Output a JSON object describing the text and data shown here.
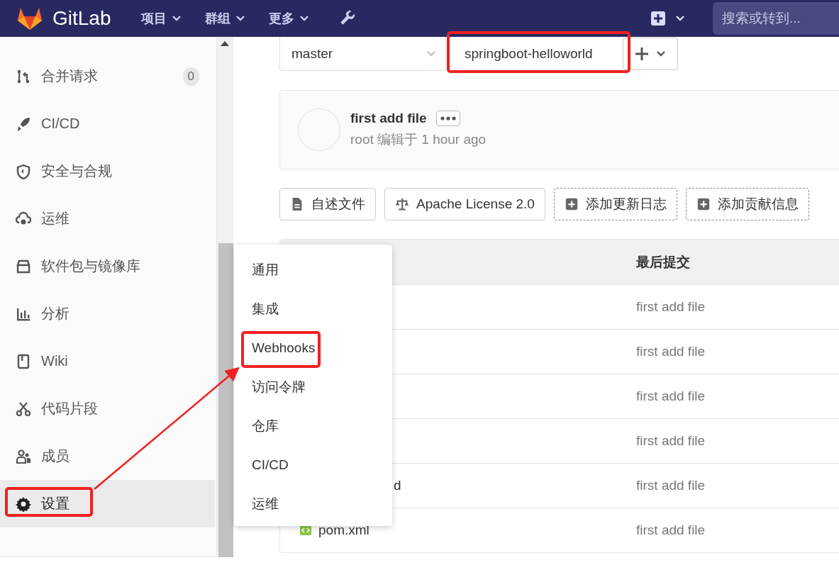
{
  "topbar": {
    "brand": "GitLab",
    "menus": [
      {
        "label": "项目"
      },
      {
        "label": "群组"
      },
      {
        "label": "更多"
      }
    ],
    "search": {
      "placeholder": "搜索或转到..."
    }
  },
  "sidebar": {
    "items": [
      {
        "label": "合并请求",
        "badge": "0",
        "selected": false
      },
      {
        "label": "CI/CD",
        "selected": false
      },
      {
        "label": "安全与合规",
        "selected": false
      },
      {
        "label": "运维",
        "selected": false
      },
      {
        "label": "软件包与镜像库",
        "selected": false
      },
      {
        "label": "分析",
        "selected": false
      },
      {
        "label": "Wiki",
        "selected": false
      },
      {
        "label": "代码片段",
        "selected": false
      },
      {
        "label": "成员",
        "selected": false
      },
      {
        "label": "设置",
        "selected": true
      }
    ]
  },
  "settings_menu": {
    "items": [
      {
        "label": "通用"
      },
      {
        "label": "集成"
      },
      {
        "label": "Webhooks"
      },
      {
        "label": "访问令牌"
      },
      {
        "label": "仓库"
      },
      {
        "label": "CI/CD"
      },
      {
        "label": "运维"
      }
    ]
  },
  "repo": {
    "branch": "master",
    "path": "springboot-helloworld"
  },
  "commit": {
    "title": "first add file",
    "meta": "root 编辑于 1 hour ago"
  },
  "shortcuts": [
    {
      "label": "自述文件",
      "kind": "existing"
    },
    {
      "label": "Apache License 2.0",
      "kind": "existing"
    },
    {
      "label": "添加更新日志",
      "kind": "add"
    },
    {
      "label": "添加贡献信息",
      "kind": "add"
    }
  ],
  "table": {
    "columns": [
      "最后提交"
    ],
    "rows": [
      {
        "kind": "hidden",
        "last_commit": "first add file"
      },
      {
        "kind": "hidden",
        "last_commit": "first add file"
      },
      {
        "kind": "hidden",
        "last_commit": "first add file"
      },
      {
        "kind": "hidden",
        "last_commit": "first add file"
      },
      {
        "kind": "partial",
        "name": "d",
        "last_commit": "first add file"
      },
      {
        "kind": "file",
        "name": "pom.xml",
        "last_commit": "first add file"
      }
    ]
  }
}
